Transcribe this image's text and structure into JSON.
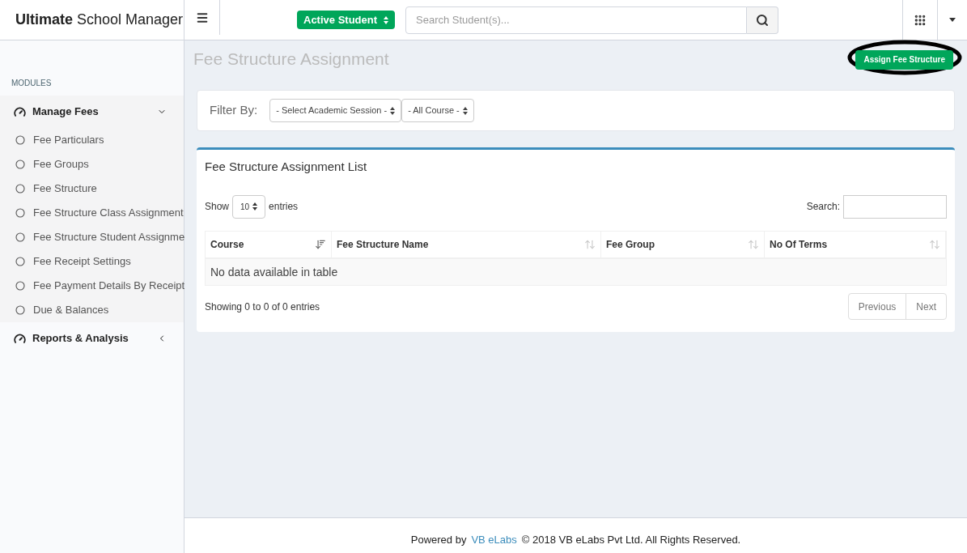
{
  "brand": {
    "bold": "Ultimate",
    "rest": "School Manager"
  },
  "student_filter": {
    "value": "Active Student"
  },
  "search": {
    "placeholder": "Search Student(s)..."
  },
  "sidebar": {
    "heading": "MODULES",
    "groups": [
      {
        "label": "Manage Fees",
        "expanded": true,
        "items": [
          {
            "label": "Fee Particulars"
          },
          {
            "label": "Fee Groups"
          },
          {
            "label": "Fee Structure"
          },
          {
            "label": "Fee Structure Class Assignment"
          },
          {
            "label": "Fee Structure Student Assignme"
          },
          {
            "label": "Fee Receipt Settings"
          },
          {
            "label": "Fee Payment Details By Receipt"
          },
          {
            "label": "Due & Balances"
          }
        ]
      },
      {
        "label": "Reports & Analysis",
        "expanded": false
      }
    ]
  },
  "page_title": "Fee Structure Assignment",
  "assign_button": {
    "label": "Assign Fee Structure",
    "highlighted": true
  },
  "filter": {
    "label": "Filter By:",
    "selects": [
      "- Select Academic Session -",
      "- All Course -"
    ]
  },
  "list": {
    "title": "Fee Structure Assignment List",
    "show_label": "Show",
    "page_size": "10",
    "entries_label": "entries",
    "search_label": "Search:",
    "columns": [
      {
        "label": "Course",
        "sorted": true
      },
      {
        "label": "Fee Structure Name",
        "sorted": false
      },
      {
        "label": "Fee Group",
        "sorted": false
      },
      {
        "label": "No Of Terms",
        "sorted": false
      }
    ],
    "empty_message": "No data available in table",
    "info": "Showing 0 to 0 of 0 entries",
    "pager": [
      "Previous",
      "Next"
    ]
  },
  "footer": {
    "prefix": "Powered by",
    "link": "VB eLabs",
    "suffix": "© 2018 VB eLabs Pvt Ltd. All Rights Reserved."
  }
}
